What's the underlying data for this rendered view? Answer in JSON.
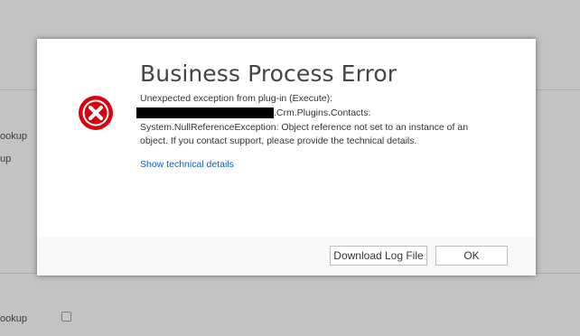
{
  "background": {
    "label_1": "ookup",
    "label_2": "up",
    "label_3": "ookup"
  },
  "dialog": {
    "title": "Business Process Error",
    "icon": "error-x-icon",
    "message": {
      "line1": "Unexpected exception from plug-in (Execute):",
      "line2_suffix": ".Crm.Plugins.Contacts:",
      "line3": "System.NullReferenceException: Object reference not set to an instance of an",
      "line4": "object. If you contact support, please provide the technical details."
    },
    "details_link": "Show technical details",
    "buttons": {
      "download_label": "Download Log File",
      "ok_label": "OK"
    }
  },
  "colors": {
    "error_red": "#d9000d",
    "link_blue": "#1160b7",
    "overlay_gray": "#c3c3c3"
  }
}
